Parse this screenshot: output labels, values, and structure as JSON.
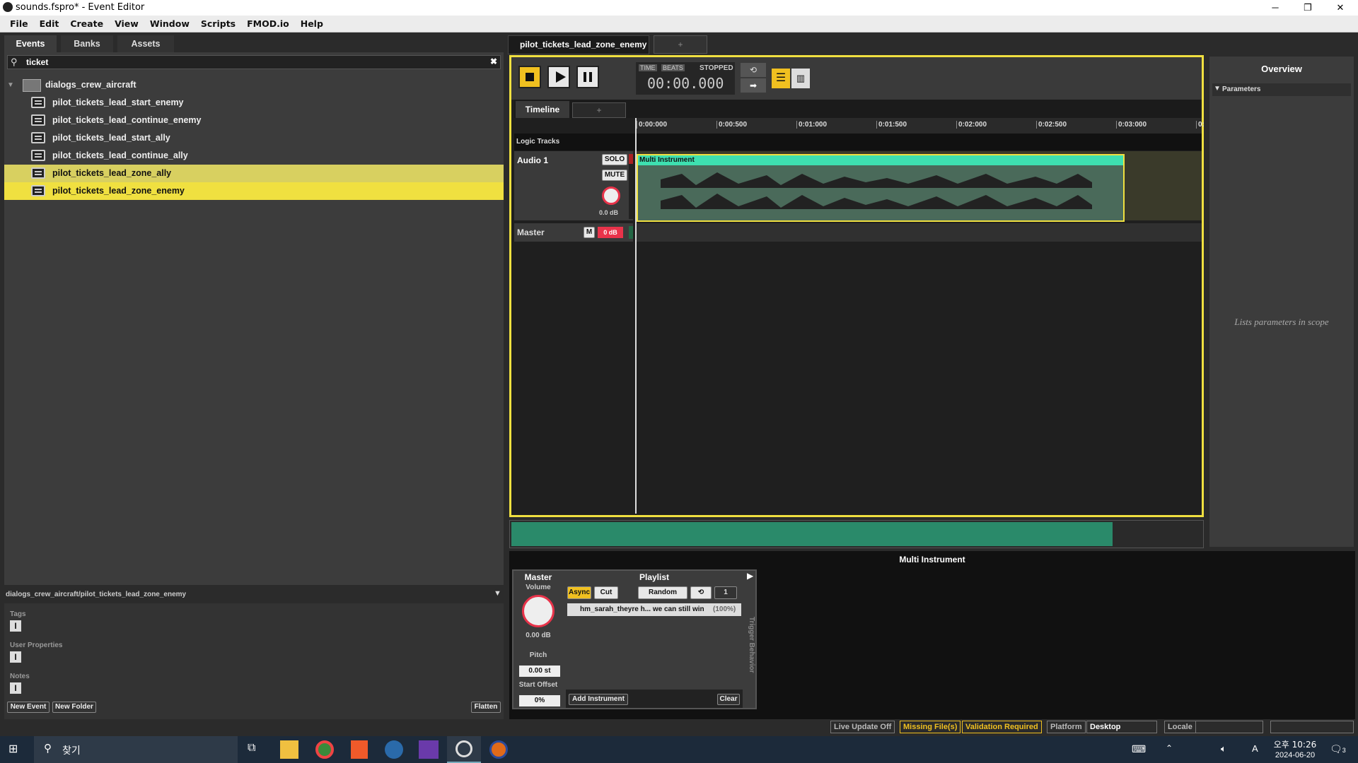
{
  "window": {
    "title": "sounds.fspro* - Event Editor",
    "min": "─",
    "max": "❐",
    "close": "✕"
  },
  "menu": [
    "File",
    "Edit",
    "Create",
    "View",
    "Window",
    "Scripts",
    "FMOD.io",
    "Help"
  ],
  "left": {
    "tabs": [
      "Events",
      "Banks",
      "Assets"
    ],
    "search": {
      "value": "ticket"
    },
    "folder": "dialogs_crew_aircraft",
    "events": [
      "pilot_tickets_lead_start_enemy",
      "pilot_tickets_lead_continue_enemy",
      "pilot_tickets_lead_start_ally",
      "pilot_tickets_lead_continue_ally",
      "pilot_tickets_lead_zone_ally",
      "pilot_tickets_lead_zone_enemy"
    ],
    "path": "dialogs_crew_aircraft/pilot_tickets_lead_zone_enemy",
    "props": {
      "tags": "Tags",
      "user_properties": "User Properties",
      "notes": "Notes"
    },
    "buttons": {
      "new_event": "New Event",
      "new_folder": "New Folder",
      "flatten": "Flatten"
    }
  },
  "editor": {
    "tab": "pilot_tickets_lead_zone_enemy",
    "add_tab": "+",
    "transport": {
      "time_label": "TIME",
      "beats_label": "BEATS",
      "state": "STOPPED",
      "time": "00:00.000"
    },
    "subtabs": {
      "timeline": "Timeline",
      "add": "+"
    },
    "ruler": [
      "0:00:000",
      "0:00:500",
      "0:01:000",
      "0:01:500",
      "0:02:000",
      "0:02:500",
      "0:03:000",
      "0:"
    ],
    "logic_tracks": "Logic Tracks",
    "audio_track": {
      "name": "Audio 1",
      "solo": "SOLO",
      "mute": "MUTE",
      "db": "0.0 dB"
    },
    "instrument_label": "Multi Instrument",
    "master_track": {
      "name": "Master",
      "m": "M",
      "db": "0 dB"
    }
  },
  "overview": {
    "title": "Overview",
    "parameters": "Parameters",
    "placeholder": "Lists parameters in scope"
  },
  "deck": {
    "title": "Multi Instrument",
    "master": "Master",
    "volume_label": "Volume",
    "volume": "0.00 dB",
    "pitch_label": "Pitch",
    "pitch": "0.00 st",
    "start_offset_label": "Start Offset",
    "start_offset": "0%",
    "playlist": "Playlist",
    "async": "Async",
    "cut": "Cut",
    "mode": "Random",
    "loop_count": "1",
    "item": "hm_sarah_theyre h... we can still win",
    "item_pct": "(100%)",
    "add_instrument": "Add Instrument",
    "clear": "Clear",
    "trigger_behavior": "Trigger Behavior"
  },
  "status": {
    "live_update": "Live Update Off",
    "missing": "Missing File(s)",
    "validation": "Validation Required",
    "platform_label": "Platform",
    "platform": "Desktop",
    "locale_label": "Locale"
  },
  "taskbar": {
    "search": "찾기",
    "time": "오후 10:26",
    "date": "2024-06-20",
    "ime": "A",
    "notif": "3"
  }
}
